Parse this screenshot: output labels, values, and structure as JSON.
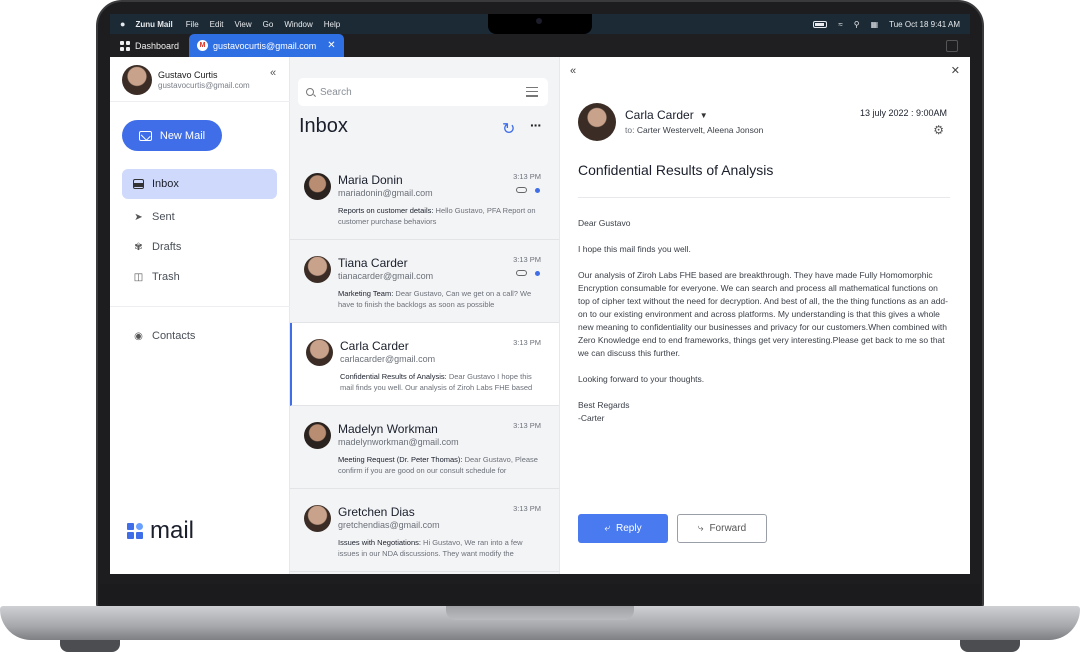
{
  "menubar": {
    "app_name": "Zunu Mail",
    "menus": [
      "File",
      "Edit",
      "View",
      "Go",
      "Window",
      "Help"
    ],
    "clock": "Tue Oct 18  9:41 AM"
  },
  "tabs": {
    "dashboard": "Dashboard",
    "active_account": "gustavocurtis@gmail.com"
  },
  "sidebar": {
    "user_name": "Gustavo Curtis",
    "user_email": "gustavocurtis@gmail.com",
    "new_mail_label": "New Mail",
    "items": [
      {
        "label": "Inbox",
        "icon": "inbox-icon"
      },
      {
        "label": "Sent",
        "icon": "send-icon"
      },
      {
        "label": "Drafts",
        "icon": "drafts-icon"
      },
      {
        "label": "Trash",
        "icon": "trash-icon"
      },
      {
        "label": "Contacts",
        "icon": "contacts-icon"
      }
    ],
    "brand": "mail"
  },
  "list": {
    "search_placeholder": "Search",
    "title": "Inbox",
    "mails": [
      {
        "name": "Maria Donin",
        "email": "mariadonin@gmail.com",
        "time": "3:13 PM",
        "subject": "Reports on customer details:",
        "preview": " Hello Gustavo, PFA Report on customer purchase behaviors",
        "unread": true
      },
      {
        "name": "Tiana Carder",
        "email": "tianacarder@gmail.com",
        "time": "3:13 PM",
        "subject": "Marketing Team:",
        "preview": " Dear Gustavo, Can we get on a call? We have to finish the backlogs as soon as possible",
        "unread": true
      },
      {
        "name": "Carla Carder",
        "email": "carlacarder@gmail.com",
        "time": "3:13 PM",
        "subject": "Confidential Results of Analysis:",
        "preview": " Dear Gustavo I hope this mail finds you well. Our analysis of Ziroh Labs FHE based",
        "unread": false
      },
      {
        "name": "Madelyn Workman",
        "email": "madelynworkman@gmail.com",
        "time": "3:13 PM",
        "subject": "Meeting Request (Dr. Peter Thomas):",
        "preview": " Dear Gustavo, Please confirm if you are good on our consult schedule for",
        "unread": false
      },
      {
        "name": "Gretchen Dias",
        "email": "gretchendias@gmail.com",
        "time": "3:13 PM",
        "subject": "Issues with Negotiations:",
        "preview": " Hi Gustavo, We ran into a few issues in our NDA discussions. They want modify the",
        "unread": false
      }
    ]
  },
  "reading": {
    "sender": "Carla Carder",
    "to_prefix": "to:",
    "to_names": "Carter Westervelt, Aleena Jonson",
    "date": "13 july 2022 : 9:00AM",
    "subject": "Confidential Results of Analysis",
    "greeting": "Dear Gustavo",
    "p1": "I hope this mail finds you well.",
    "p2": "Our analysis of Ziroh Labs FHE based are breakthrough. They have made Fully Homomorphic Encryption consumable for everyone. We can search and process all mathematical functions on top of cipher text without the need for decryption. And best of all, the the thing functions as an add-on to our existing environment and across platforms. My understanding is that this gives a whole new meaning to confidentiality our businesses and privacy for our customers.When combined with Zero Knowledge end to end frameworks, things get very interesting.Please get back to me so that we can discuss this further.",
    "p3": "Looking forward to your thoughts.",
    "sign1": "Best Regards",
    "sign2": "-Carter",
    "reply_label": "Reply",
    "forward_label": "Forward"
  },
  "colors": {
    "accent": "#3f6ee8",
    "active_nav": "#cfd9fb",
    "list_bg": "#f3f4f6"
  }
}
